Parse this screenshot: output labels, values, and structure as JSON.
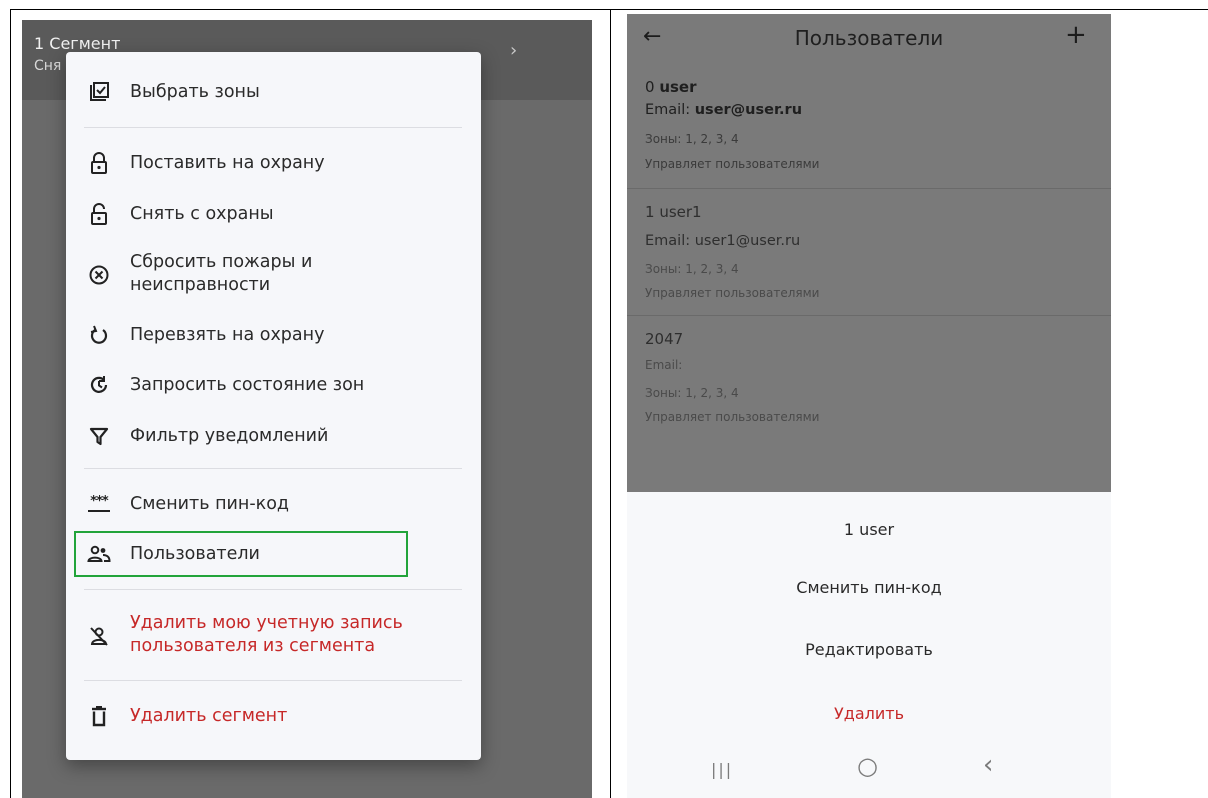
{
  "left": {
    "topbar": {
      "title": "1 Сегмент",
      "subtitle": "Сня",
      "chevron": "›"
    },
    "menu": {
      "items": [
        {
          "label": "Выбрать зоны",
          "icon": "checklist-icon"
        },
        {
          "label": "Поставить на охрану",
          "icon": "lock-icon"
        },
        {
          "label": "Снять с охраны",
          "icon": "unlock-icon"
        },
        {
          "label": "Сбросить пожары и неисправности",
          "icon": "cancel-circle-icon"
        },
        {
          "label": "Перевзять на охрану",
          "icon": "refresh-icon"
        },
        {
          "label": "Запросить состояние зон",
          "icon": "history-icon"
        },
        {
          "label": "Фильтр уведомлений",
          "icon": "filter-icon"
        },
        {
          "label": "Сменить пин-код",
          "icon": "password-icon",
          "glyph": "***"
        },
        {
          "label": "Пользователи",
          "icon": "users-icon"
        },
        {
          "label": "Удалить мою учетную запись пользователя из сегмента",
          "icon": "remove-user-icon"
        },
        {
          "label": "Удалить сегмент",
          "icon": "trash-icon"
        }
      ]
    },
    "highlight_color": "#22a43a",
    "danger_color": "#c62828"
  },
  "right": {
    "header": {
      "back": "←",
      "title": "Пользователи",
      "add": "+"
    },
    "users": [
      {
        "id": "0",
        "name": "user",
        "email_label": "Email:",
        "email": "user@user.ru",
        "zones": "Зоны: 1, 2, 3, 4",
        "role": "Управляет пользователями"
      },
      {
        "id": "1",
        "name": "user1",
        "email_label": "Email:",
        "email": "user1@user.ru",
        "zones": "Зоны: 1, 2, 3, 4",
        "role": "Управляет пользователями"
      },
      {
        "id": "2047",
        "name": "",
        "email_label": "Email:",
        "email": "",
        "zones": "Зоны: 1, 2, 3, 4",
        "role": "Управляет пользователями"
      }
    ],
    "sheet": {
      "title": "1 user",
      "actions": [
        "Сменить пин-код",
        "Редактировать",
        "Удалить"
      ]
    },
    "navbar": {
      "recents": "|||",
      "home": "○",
      "back": "‹"
    }
  }
}
